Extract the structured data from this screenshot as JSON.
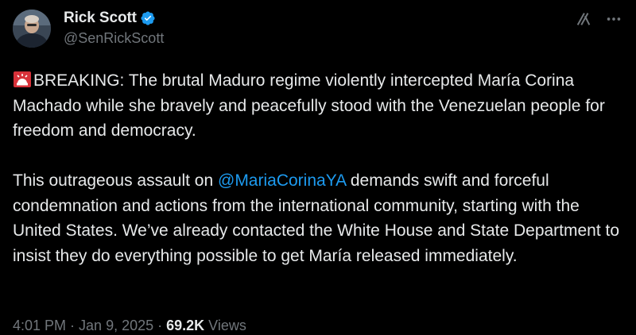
{
  "author": {
    "display_name": "Rick Scott",
    "handle": "@SenRickScott",
    "verified_icon": "verified-badge-icon"
  },
  "actions": {
    "grok_icon": "grok-icon",
    "more_icon": "more-horizontal-icon"
  },
  "tweet": {
    "paragraph1": {
      "emoji": "siren-emoji",
      "text": "BREAKING: The brutal Maduro regime violently intercepted María Corina Machado while she bravely and peacefully stood with the Venezuelan people for freedom and democracy."
    },
    "paragraph2": {
      "before": "This outrageous assault on ",
      "mention": "@MariaCorinaYA",
      "after": " demands swift and forceful condemnation and actions from the international community, starting with the United States. We’ve already contacted the White House and State Department to insist they do everything possible to get María released immediately."
    }
  },
  "meta": {
    "time": "4:01 PM",
    "separator": " · ",
    "date": "Jan 9, 2025",
    "views_count": "69.2K",
    "views_label": " Views"
  },
  "colors": {
    "background": "#000000",
    "text": "#e7e9ea",
    "secondary": "#71767b",
    "link": "#1d9bf0",
    "verified": "#1d9bf0"
  }
}
